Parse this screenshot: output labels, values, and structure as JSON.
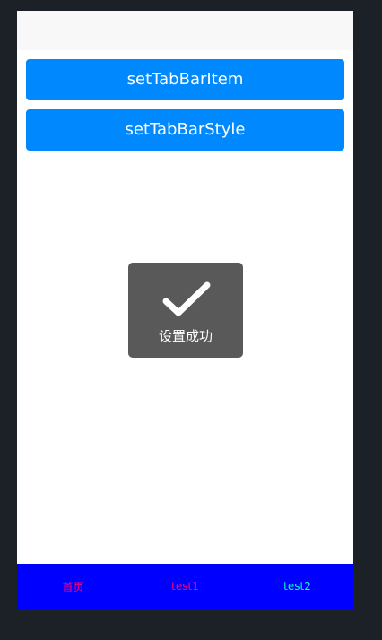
{
  "buttons": {
    "set_tab_bar_item": "setTabBarItem",
    "set_tab_bar_style": "setTabBarStyle"
  },
  "toast": {
    "icon": "checkmark-icon",
    "message": "设置成功"
  },
  "tab_bar": {
    "background": "#0000ff",
    "items": [
      {
        "label": "首页",
        "color": "#ff0080"
      },
      {
        "label": "test1",
        "color": "#ff0080"
      },
      {
        "label": "test2",
        "color": "#00ffcc"
      }
    ]
  }
}
